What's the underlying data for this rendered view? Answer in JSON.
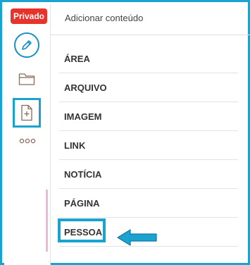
{
  "sidebar": {
    "badge_label": "Privado",
    "icons": [
      "edit-icon",
      "folder-icon",
      "new-page-icon",
      "more-icon"
    ]
  },
  "panel": {
    "title": "Adicionar conteúdo",
    "items": [
      {
        "label": "ÁREA"
      },
      {
        "label": "ARQUIVO"
      },
      {
        "label": "IMAGEM"
      },
      {
        "label": "LINK"
      },
      {
        "label": "NOTÍCIA"
      },
      {
        "label": "PÁGINA"
      },
      {
        "label": "PESSOA"
      }
    ]
  },
  "colors": {
    "accent": "#1aa3cf",
    "badge": "#e8332b",
    "text": "#333333"
  }
}
